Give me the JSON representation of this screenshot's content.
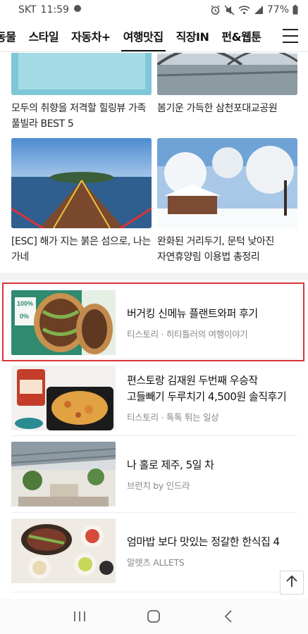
{
  "status_bar": {
    "carrier": "SKT",
    "time": "11:59",
    "battery": "77%"
  },
  "tabs": [
    {
      "label": "동물"
    },
    {
      "label": "스타일"
    },
    {
      "label": "자동차+"
    },
    {
      "label": "여행맛집",
      "active": true
    },
    {
      "label": "직장IN"
    },
    {
      "label": "펀&웹툰"
    }
  ],
  "grid": [
    {
      "title": "모두의 취향을 저격할 힐링뷰 가족 풀빌라 BEST 5"
    },
    {
      "title": "봄기운 가득한 삼천포대교공원"
    },
    {
      "title": "[ESC] 해가 지는 붉은 섬으로, 나는 가네"
    },
    {
      "title": "완화된 거리두기, 문턱 낮아진 자연휴양림 이용법 총정리"
    }
  ],
  "list": [
    {
      "title": "버거킹 신메뉴 플랜트와퍼 후기",
      "source": "티스토리 · 히티틀러의 여행이야기"
    },
    {
      "title": "편스토랑 김재원 두번째 우승작 고들빼기 두루치기 4,500원 솔직후기",
      "source": "티스토리 · 톡톡 튀는 일상"
    },
    {
      "title": "나 홀로 제주, 5일 차",
      "source": "브런치 by 인드라"
    },
    {
      "title": "엄마밥 보다 맛있는 정갈한 한식집 4",
      "source": "알렛츠 ALLETS"
    }
  ],
  "thumb_packaging_text": {
    "percent_top": "100%",
    "percent_mid": "0%"
  },
  "colors": {
    "highlight": "#d8343b",
    "divider": "#f2f2f2"
  }
}
